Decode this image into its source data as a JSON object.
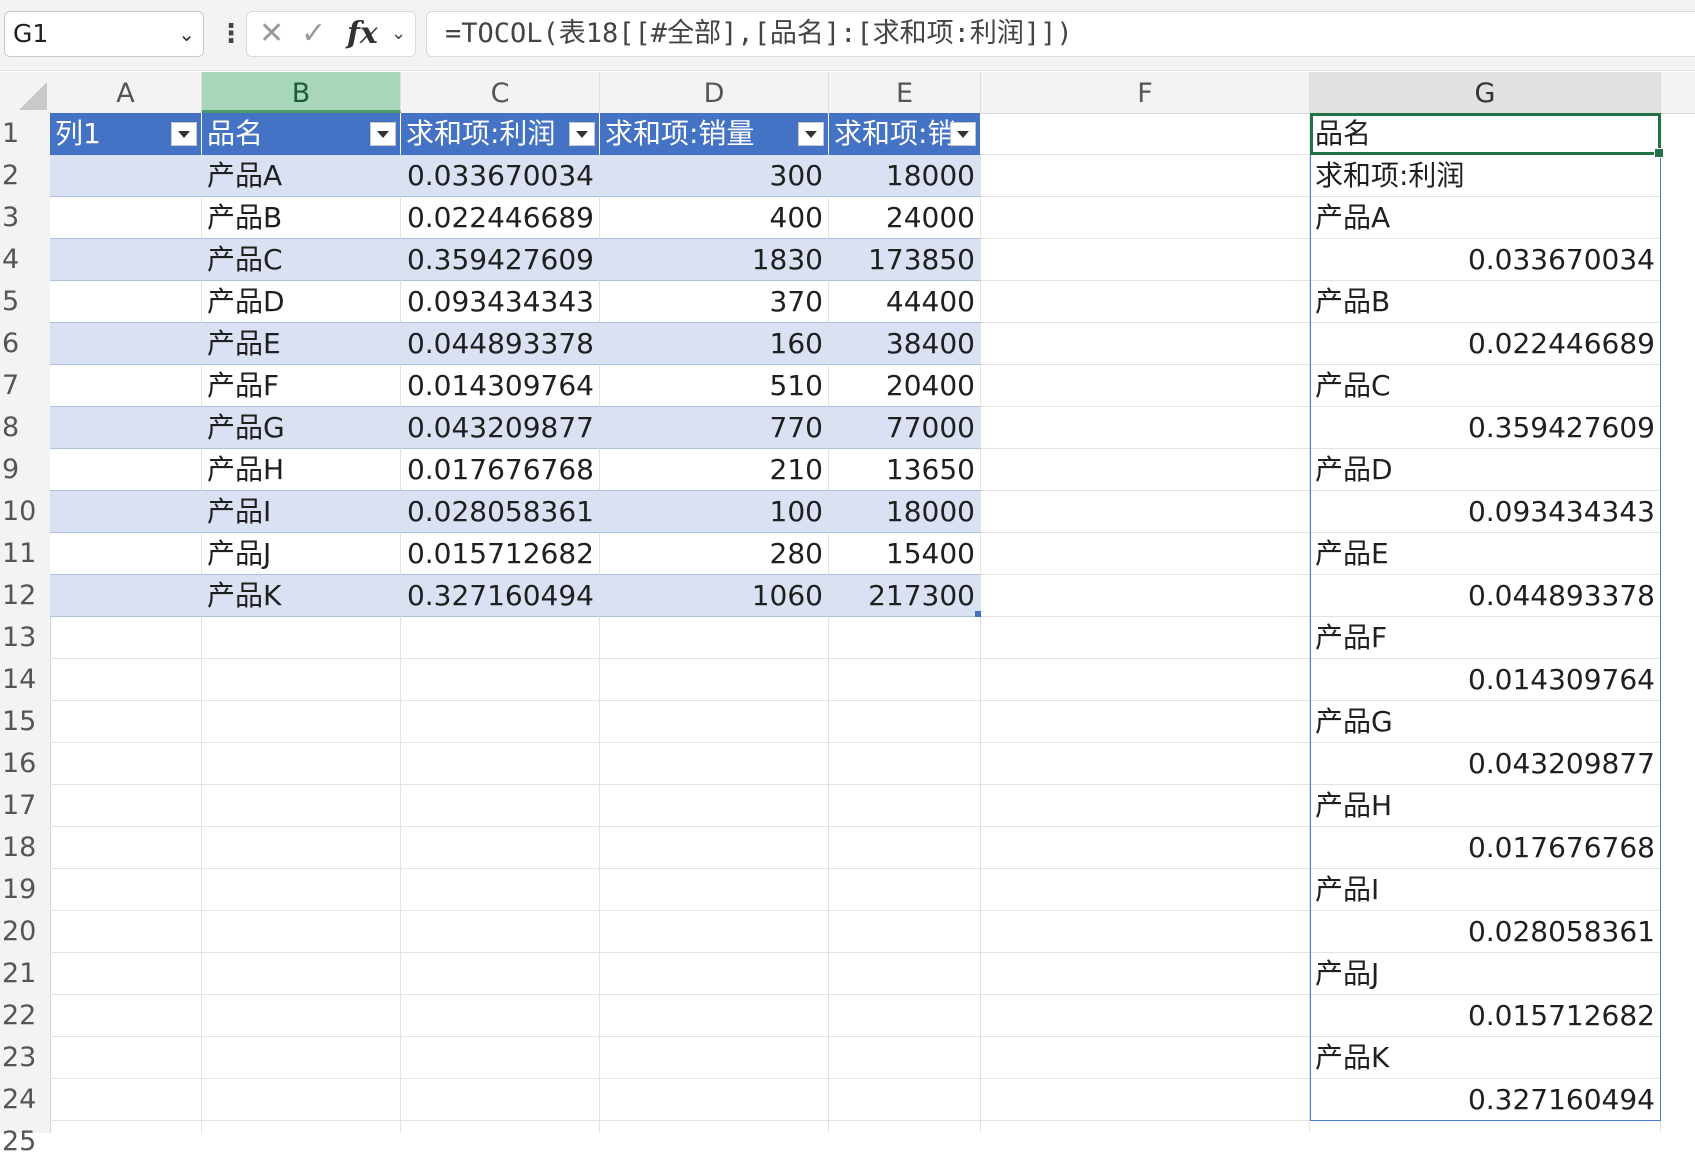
{
  "formula_bar": {
    "name_box": "G1",
    "formula": "=TOCOL(表18[[#全部],[品名]:[求和项:利润]])"
  },
  "column_headers": [
    "A",
    "B",
    "C",
    "D",
    "E",
    "F",
    "G"
  ],
  "row_headers": [
    "1",
    "2",
    "3",
    "4",
    "5",
    "6",
    "7",
    "8",
    "9",
    "10",
    "11",
    "12",
    "13",
    "14",
    "15",
    "16",
    "17",
    "18",
    "19",
    "20",
    "21",
    "22",
    "23",
    "24",
    "25"
  ],
  "table": {
    "headers": [
      "列1",
      "品名",
      "求和项:利润",
      "求和项:销量",
      "求和项:销"
    ],
    "rows": [
      [
        "",
        "产品A",
        "0.033670034",
        "300",
        "18000"
      ],
      [
        "",
        "产品B",
        "0.022446689",
        "400",
        "24000"
      ],
      [
        "",
        "产品C",
        "0.359427609",
        "1830",
        "173850"
      ],
      [
        "",
        "产品D",
        "0.093434343",
        "370",
        "44400"
      ],
      [
        "",
        "产品E",
        "0.044893378",
        "160",
        "38400"
      ],
      [
        "",
        "产品F",
        "0.014309764",
        "510",
        "20400"
      ],
      [
        "",
        "产品G",
        "0.043209877",
        "770",
        "77000"
      ],
      [
        "",
        "产品H",
        "0.017676768",
        "210",
        "13650"
      ],
      [
        "",
        "产品I",
        "0.028058361",
        "100",
        "18000"
      ],
      [
        "",
        "产品J",
        "0.015712682",
        "280",
        "15400"
      ],
      [
        "",
        "产品K",
        "0.327160494",
        "1060",
        "217300"
      ]
    ]
  },
  "spill_column_g": [
    "品名",
    "求和项:利润",
    "产品A",
    "0.033670034",
    "产品B",
    "0.022446689",
    "产品C",
    "0.359427609",
    "产品D",
    "0.093434343",
    "产品E",
    "0.044893378",
    "产品F",
    "0.014309764",
    "产品G",
    "0.043209877",
    "产品H",
    "0.017676768",
    "产品I",
    "0.028058361",
    "产品J",
    "0.015712682",
    "产品K",
    "0.327160494"
  ],
  "colors": {
    "table_header": "#4472c4",
    "table_band": "#d9e1f2",
    "selection": "#217346",
    "selected_col_header": "#a7d7b8"
  },
  "icons": [
    "chevron-down-icon",
    "more-icon",
    "cancel-icon",
    "enter-icon",
    "function-icon",
    "filter-dropdown-icon"
  ]
}
